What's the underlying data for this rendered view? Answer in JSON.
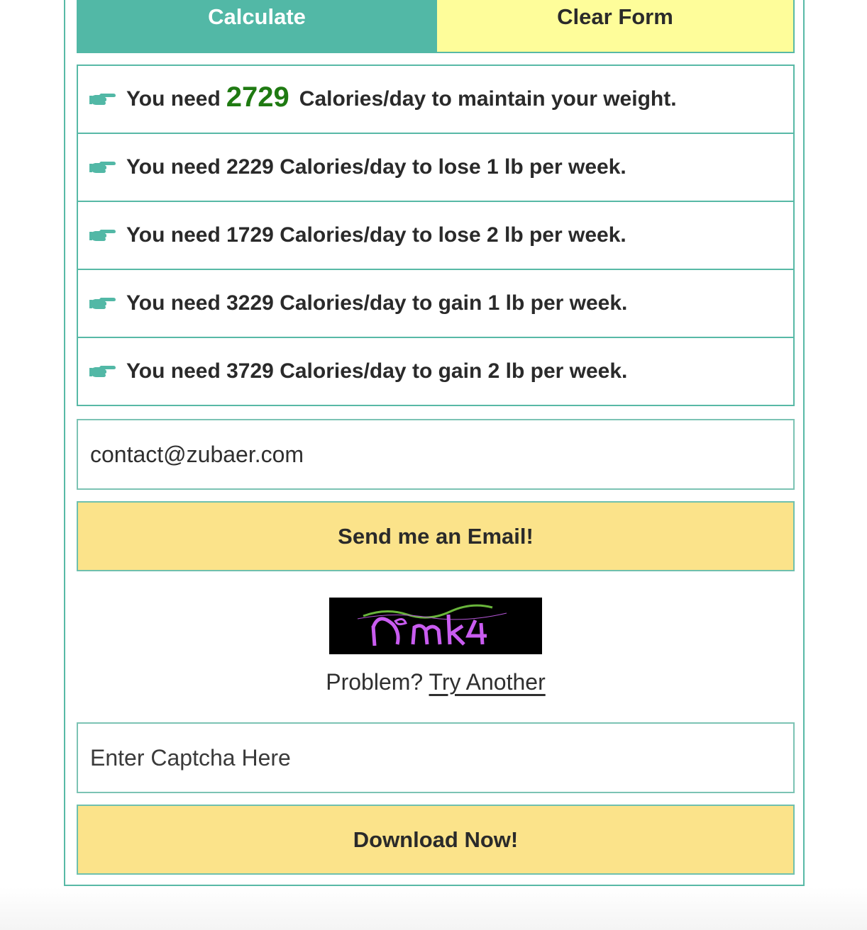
{
  "buttons": {
    "calculate_label": "Calculate",
    "clear_label": "Clear Form"
  },
  "results": {
    "maintain": {
      "prefix": "You need",
      "calories": "2729",
      "suffix": "Calories/day to maintain your weight."
    },
    "rows": [
      {
        "text": "You need 2229 Calories/day to lose 1 lb per week."
      },
      {
        "text": "You need 1729 Calories/day to lose 2 lb per week."
      },
      {
        "text": "You need 3229 Calories/day to gain 1 lb per week."
      },
      {
        "text": "You need 3729 Calories/day to gain 2 lb per week."
      }
    ]
  },
  "email": {
    "value": "contact@zubaer.com"
  },
  "send_button": {
    "label": "Send me an Email!"
  },
  "captcha": {
    "image_text": "nemk4",
    "problem_text": "Problem?",
    "try_another_label": "Try Another",
    "placeholder": "Enter Captcha Here"
  },
  "download_button": {
    "label": "Download Now!"
  },
  "colors": {
    "teal": "#52b8a6",
    "light_yellow": "#fefd9a",
    "button_yellow": "#fbe38a",
    "green_number": "#1f7a12"
  },
  "icons": {
    "result_bullet": "pointing-hand-icon"
  }
}
